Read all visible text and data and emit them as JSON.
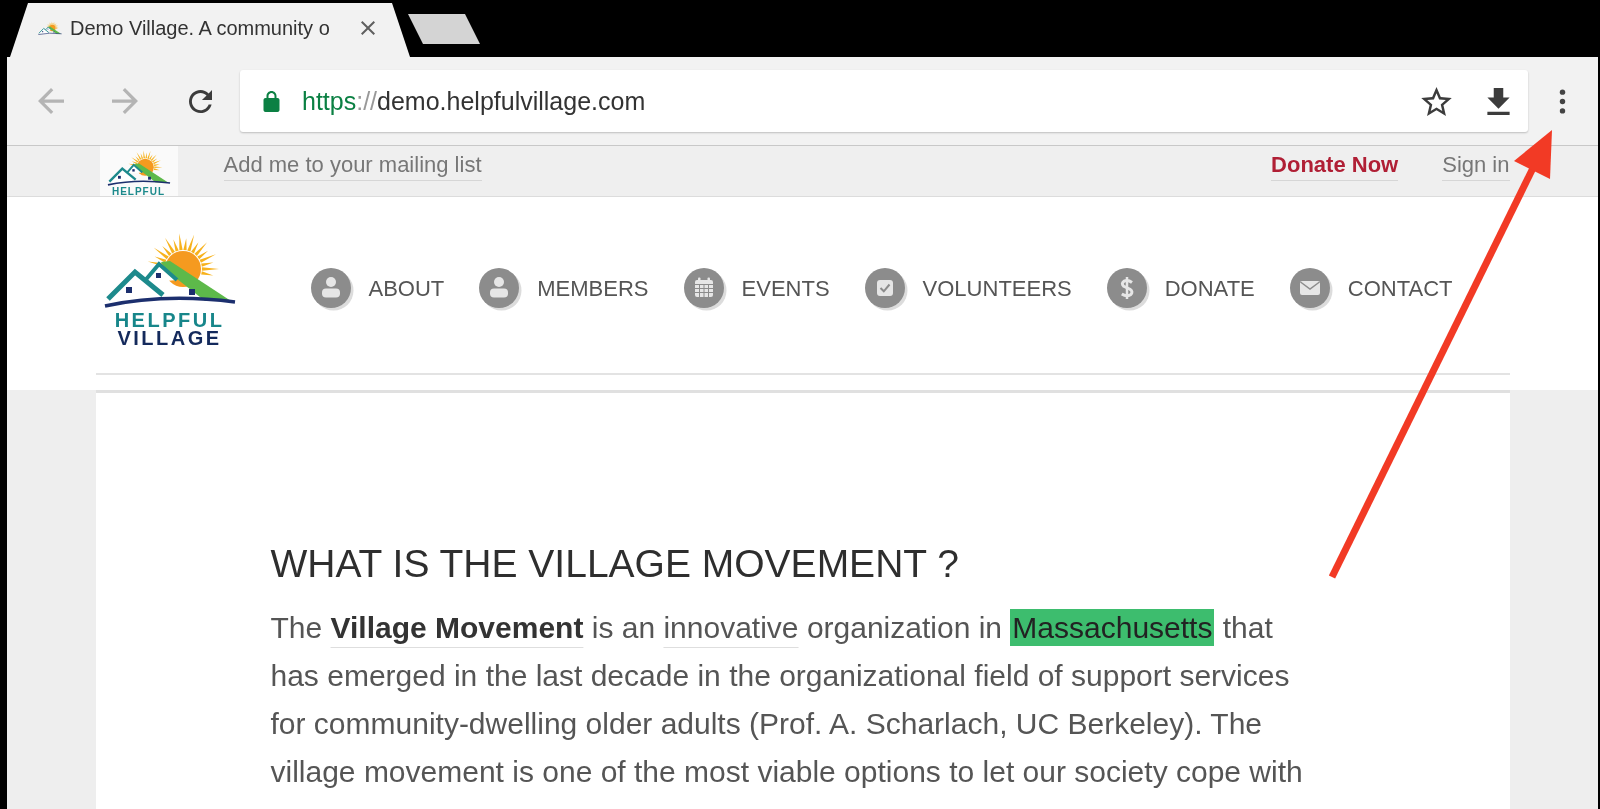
{
  "browser": {
    "tabs": [
      {
        "title": "Demo Village. A community o",
        "selected": true
      }
    ],
    "nav_buttons": [
      {
        "kind": "back",
        "disabled": true
      },
      {
        "kind": "forward",
        "disabled": true
      },
      {
        "kind": "reload",
        "disabled": false
      }
    ],
    "address_bar": {
      "secure": true,
      "scheme": "https",
      "separator": "://",
      "host": "demo.helpfulvillage.com",
      "bookmarked": false
    }
  },
  "utility_bar": {
    "logo": {
      "line_1": "HELPFUL"
    },
    "links": [
      {
        "label": "Add me to your mailing list",
        "kind": "secondary"
      },
      {
        "label": "Donate Now",
        "kind": "primary"
      },
      {
        "label": "Sign in",
        "kind": "secondary"
      }
    ]
  },
  "header": {
    "logo": {
      "line_1": "HELPFUL",
      "line_2": "VILLAGE"
    },
    "nav": [
      {
        "label": "ABOUT"
      },
      {
        "label": "MEMBERS"
      },
      {
        "label": "EVENTS"
      },
      {
        "label": "VOLUNTEERS"
      },
      {
        "label": "DONATE"
      },
      {
        "label": "CONTACT"
      }
    ]
  },
  "article": {
    "heading": "WHAT IS THE VILLAGE MOVEMENT ?",
    "paragraph": [
      {
        "kind": "text",
        "text": "The "
      },
      {
        "kind": "bold_link",
        "text": "Village Movement"
      },
      {
        "kind": "text",
        "text": " is an "
      },
      {
        "kind": "link",
        "text": "innovative"
      },
      {
        "kind": "text",
        "text": " organization in "
      },
      {
        "kind": "highlight",
        "text": "Massachusetts"
      },
      {
        "kind": "text",
        "text": " that has emerged in the last decade in the organizational field of support services for community-dwelling older adults (Prof. A. Scharlach, UC Berkeley). The village movement is one of the most viable options to let our society cope with"
      }
    ]
  }
}
